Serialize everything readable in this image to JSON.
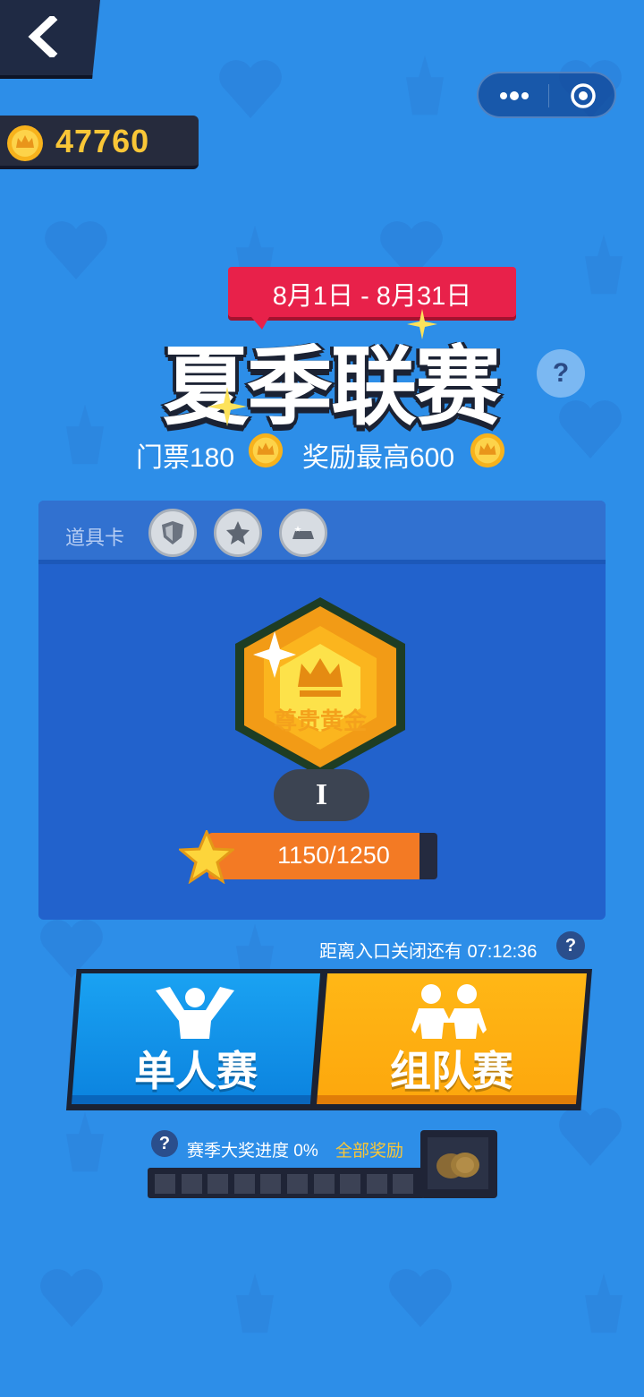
{
  "coins": {
    "value": "47760"
  },
  "season": {
    "date_range": "8月1日 - 8月31日",
    "title": "夏季联赛",
    "ticket_label": "门票180",
    "reward_label": "奖励最高600"
  },
  "panel": {
    "props_label": "道具卡",
    "props": [
      "shield-icon",
      "star-icon",
      "hat-icon"
    ],
    "rank_name": "尊贵黄金",
    "tier": "I",
    "score": "1150/1250",
    "score_progress": 0.92
  },
  "countdown": "距离入口关闭还有 07:12:36",
  "modes": {
    "single_label": "单人赛",
    "team_label": "组队赛"
  },
  "season_progress": {
    "help": "?",
    "text": "赛季大奖进度 0%",
    "reward_link": "全部奖励",
    "segments": 10,
    "progress": 0
  },
  "colors": {
    "background": "#2d8ee8",
    "single_button": "#0c85e0",
    "team_button": "#fda80d",
    "coin": "#f9c637",
    "ribbon": "#e8214a"
  }
}
